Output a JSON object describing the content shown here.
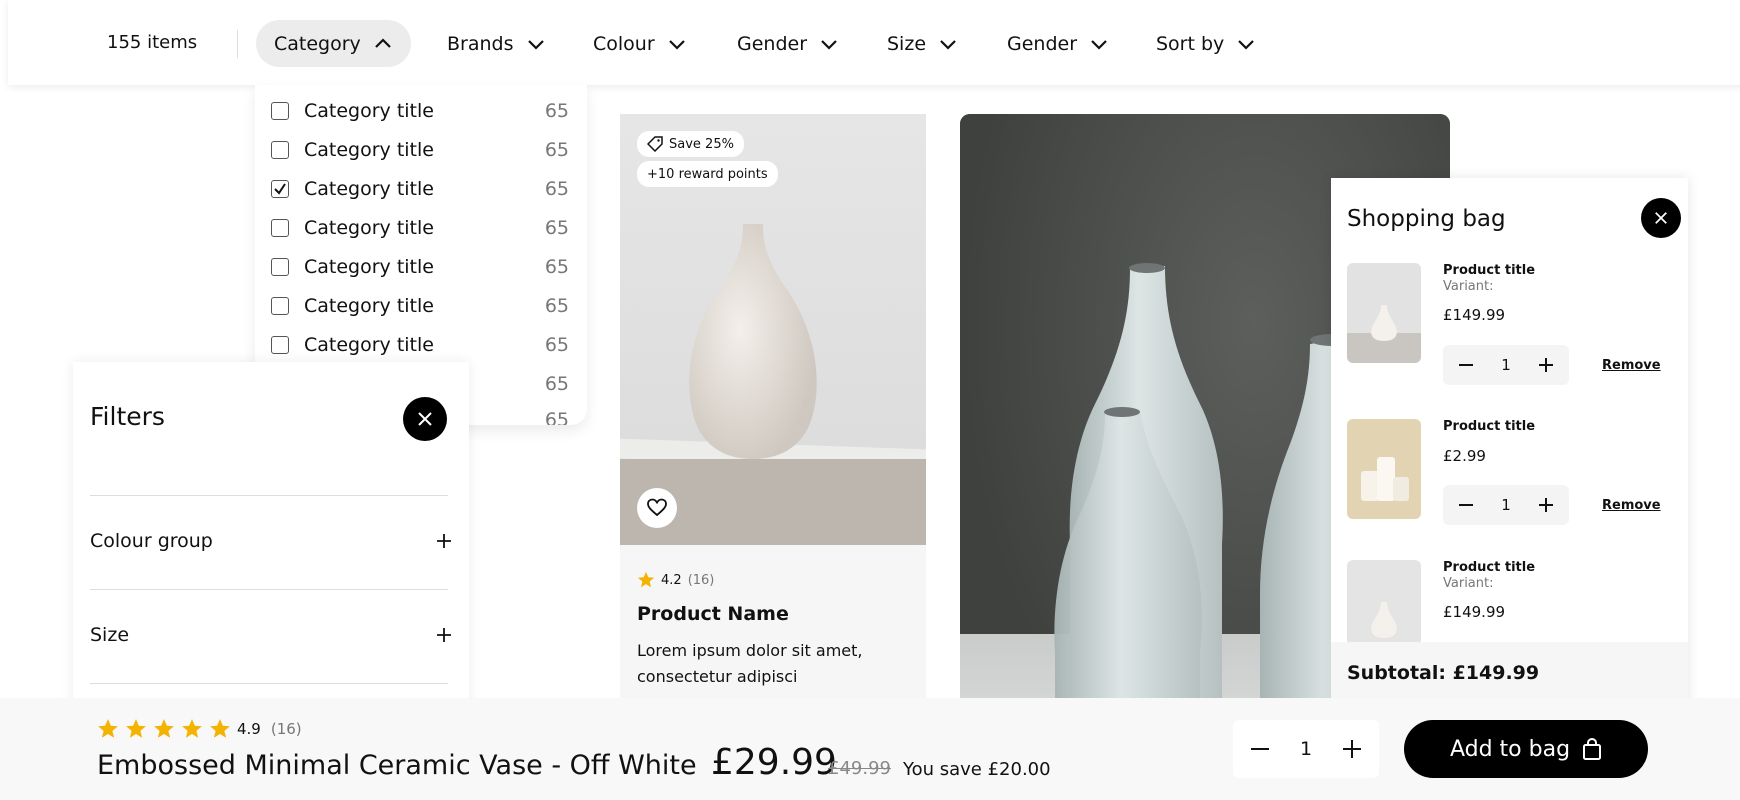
{
  "toolbar": {
    "items_count": "155 items",
    "filters": [
      {
        "label": "Category",
        "icon": "chevron-up-icon",
        "active": true
      },
      {
        "label": "Brands",
        "icon": "chevron-down-icon"
      },
      {
        "label": "Colour",
        "icon": "chevron-down-icon"
      },
      {
        "label": "Gender",
        "icon": "chevron-down-icon"
      },
      {
        "label": "Size",
        "icon": "chevron-down-icon"
      },
      {
        "label": "Gender",
        "icon": "chevron-down-icon"
      },
      {
        "label": "Sort by",
        "icon": "chevron-down-icon"
      }
    ]
  },
  "category_dropdown": {
    "items": [
      {
        "label": "Category title",
        "count": "65",
        "checked": false
      },
      {
        "label": "Category title",
        "count": "65",
        "checked": false
      },
      {
        "label": "Category title",
        "count": "65",
        "checked": true
      },
      {
        "label": "Category title",
        "count": "65",
        "checked": false
      },
      {
        "label": "Category title",
        "count": "65",
        "checked": false
      },
      {
        "label": "Category title",
        "count": "65",
        "checked": false
      },
      {
        "label": "Category title",
        "count": "65",
        "checked": false
      },
      {
        "label": "",
        "count": "65",
        "checked": false
      },
      {
        "label": "",
        "count": "65",
        "checked": false
      }
    ]
  },
  "product_card": {
    "badges": [
      "Save 25%",
      "+10 reward points"
    ],
    "rating": "4.2",
    "reviews": "(16)",
    "name": "Product Name",
    "description": "Lorem ipsum dolor sit amet, consectetur adipisci"
  },
  "filters_panel": {
    "title": "Filters",
    "sections": [
      "Colour group",
      "Size"
    ]
  },
  "shopping_bag": {
    "title": "Shopping bag",
    "items": [
      {
        "title": "Product title",
        "variant": "Variant:",
        "price": "£149.99",
        "qty": "1",
        "remove": "Remove"
      },
      {
        "title": "Product title",
        "variant": "",
        "price": "£2.99",
        "qty": "1",
        "remove": "Remove"
      },
      {
        "title": "Product title",
        "variant": "Variant:",
        "price": "£149.99",
        "qty": "1",
        "remove": "Remove"
      }
    ],
    "subtotal": "Subtotal: £149.99"
  },
  "bottom_bar": {
    "rating": "4.9",
    "reviews": "(16)",
    "stars": 5,
    "title": "Embossed Minimal Ceramic Vase - Off White",
    "price": "£29.99",
    "old_price": "£49.99",
    "savings": "You save £20.00",
    "qty": "1",
    "add_to_bag": "Add to bag"
  },
  "colors": {
    "accent": "#000000",
    "star": "#f5b301",
    "active_chip": "#ececec"
  }
}
